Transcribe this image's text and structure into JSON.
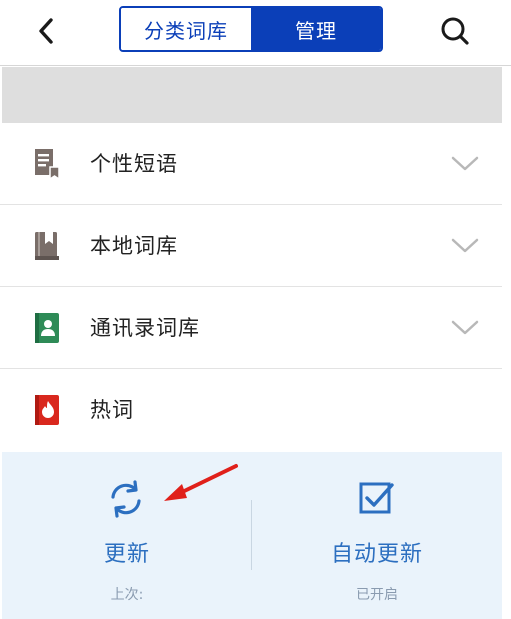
{
  "header": {
    "tabs": [
      {
        "label": "分类词库",
        "active": false
      },
      {
        "label": "管理",
        "active": true
      }
    ],
    "back_icon": "chevron-left-icon",
    "search_icon": "search-icon",
    "accent_color": "#0b3fb8"
  },
  "dictionaries": [
    {
      "label": "个性短语",
      "icon": "phrase-book-icon",
      "expandable": true
    },
    {
      "label": "本地词库",
      "icon": "local-book-icon",
      "expandable": true
    },
    {
      "label": "通讯录词库",
      "icon": "contacts-book-icon",
      "expandable": true
    },
    {
      "label": "热词",
      "icon": "hot-words-icon",
      "expandable": false
    }
  ],
  "actions": {
    "update": {
      "label": "更新",
      "sub": "上次:",
      "icon": "refresh-icon"
    },
    "auto_update": {
      "label": "自动更新",
      "sub": "已开启",
      "icon": "checkbox-checked-icon"
    }
  }
}
